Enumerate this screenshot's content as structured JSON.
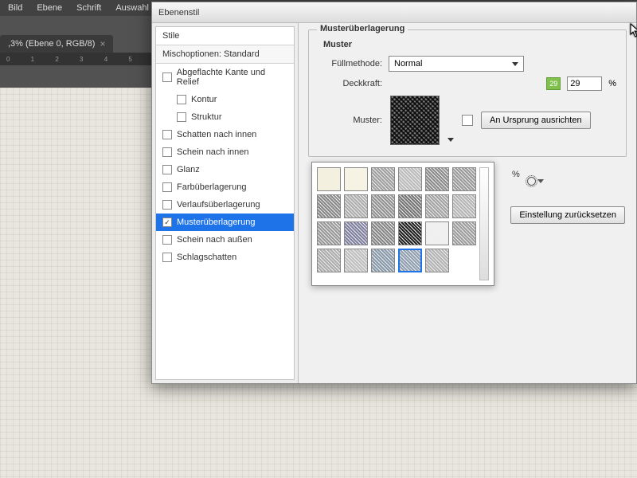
{
  "menu": {
    "items": [
      "Bild",
      "Ebene",
      "Schrift",
      "Auswahl"
    ]
  },
  "doc": {
    "tab": ",3% (Ebene 0, RGB/8)",
    "close": "×"
  },
  "dialog": {
    "title": "Ebenenstil",
    "stylesHead": "Stile",
    "blend": "Mischoptionen: Standard",
    "items": [
      {
        "label": "Abgeflachte Kante und Relief",
        "checked": false,
        "indent": false
      },
      {
        "label": "Kontur",
        "checked": false,
        "indent": true
      },
      {
        "label": "Struktur",
        "checked": false,
        "indent": true
      },
      {
        "label": "Schatten nach innen",
        "checked": false,
        "indent": false
      },
      {
        "label": "Schein nach innen",
        "checked": false,
        "indent": false
      },
      {
        "label": "Glanz",
        "checked": false,
        "indent": false
      },
      {
        "label": "Farbüberlagerung",
        "checked": false,
        "indent": false
      },
      {
        "label": "Verlaufsüberlagerung",
        "checked": false,
        "indent": false
      },
      {
        "label": "Musterüberlagerung",
        "checked": true,
        "indent": false
      },
      {
        "label": "Schein nach außen",
        "checked": false,
        "indent": false
      },
      {
        "label": "Schlagschatten",
        "checked": false,
        "indent": false
      }
    ]
  },
  "panel": {
    "legend": "Musterüberlagerung",
    "sublegend": "Muster",
    "fillLabel": "Füllmethode:",
    "fillMode": "Normal",
    "opacityLabel": "Deckkraft:",
    "opacityValue": "29",
    "pct": "%",
    "musterLabel": "Muster:",
    "snapBtn": "An Ursprung ausrichten",
    "loosePct": "%",
    "resetBtn": "Einstellung zurücksetzen"
  },
  "picker": {
    "swatches": [
      "#f4f0e0",
      "#f6f2e4",
      "#a0a0a0",
      "#bcbcbc",
      "#8c8c8c",
      "#9a9a9a",
      "#888",
      "#aeaeae",
      "#929292",
      "#767676",
      "#a4a4a4",
      "#b6b6b6",
      "#989898",
      "#8080a0",
      "#868686",
      "#222222",
      "#f0f0f0",
      "#9e9e9e",
      "#adadad",
      "#c0c0c0",
      "#8899aa",
      "#90a0b0",
      "#b4b4b4",
      ""
    ],
    "selected": 21
  }
}
